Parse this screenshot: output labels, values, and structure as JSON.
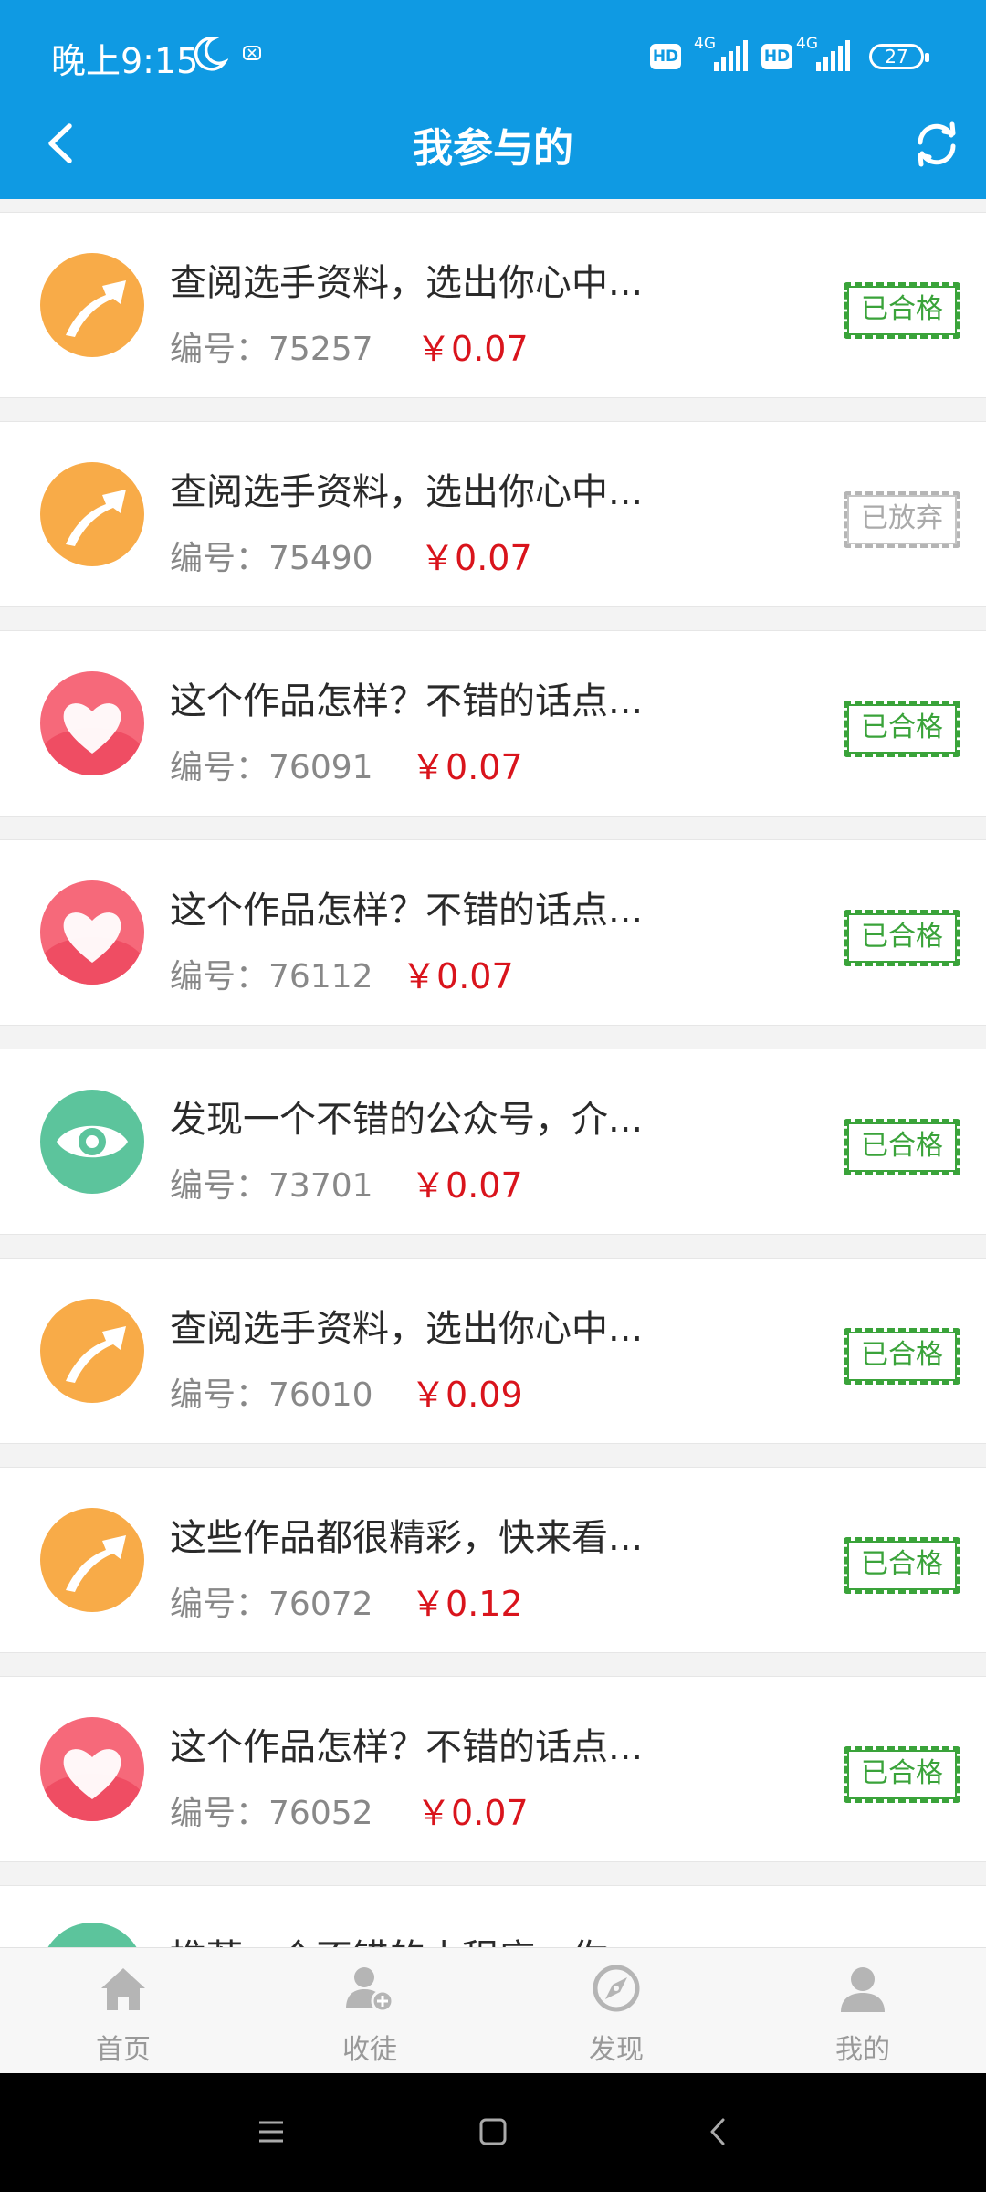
{
  "status_bar": {
    "time": "晚上9:15",
    "battery": "27",
    "network_1": "4G",
    "network_2": "4G",
    "hd_1": "HD",
    "hd_2": "HD"
  },
  "header": {
    "title": "我参与的",
    "bg_color": "#0f9ae3"
  },
  "labels": {
    "number_prefix": "编号：",
    "currency": "￥"
  },
  "tasks": [
    {
      "title": "查阅选手资料，选出你心中...",
      "number": "75257",
      "price": "0.07",
      "status": "已合格",
      "icon": "arrow-up-right-icon"
    },
    {
      "title": "查阅选手资料，选出你心中...",
      "number": "75490",
      "price": "0.07",
      "status": "已放弃",
      "icon": "arrow-up-right-icon"
    },
    {
      "title": "这个作品怎样？不错的话点...",
      "number": "76091",
      "price": "0.07",
      "status": "已合格",
      "icon": "heart-icon"
    },
    {
      "title": "这个作品怎样？不错的话点...",
      "number": "76112",
      "price": "0.07",
      "status": "已合格",
      "icon": "heart-icon"
    },
    {
      "title": "发现一个不错的公众号，介...",
      "number": "73701",
      "price": "0.07",
      "status": "已合格",
      "icon": "eye-icon"
    },
    {
      "title": "查阅选手资料，选出你心中...",
      "number": "76010",
      "price": "0.09",
      "status": "已合格",
      "icon": "arrow-up-right-icon"
    },
    {
      "title": "这些作品都很精彩，快来看...",
      "number": "76072",
      "price": "0.12",
      "status": "已合格",
      "icon": "arrow-up-right-icon"
    },
    {
      "title": "这个作品怎样？不错的话点...",
      "number": "76052",
      "price": "0.07",
      "status": "已合格",
      "icon": "heart-icon"
    }
  ],
  "partial_item": {
    "title": "推荐一个不错的小程序，你..."
  },
  "tabbar": [
    {
      "label": "首页",
      "icon": "home-icon"
    },
    {
      "label": "收徒",
      "icon": "add-user-icon"
    },
    {
      "label": "发现",
      "icon": "compass-icon"
    },
    {
      "label": "我的",
      "icon": "user-icon"
    }
  ],
  "colors": {
    "price": "#d9141c",
    "status_ok": "#3aa33a",
    "status_abandoned": "#aaaaaa"
  }
}
